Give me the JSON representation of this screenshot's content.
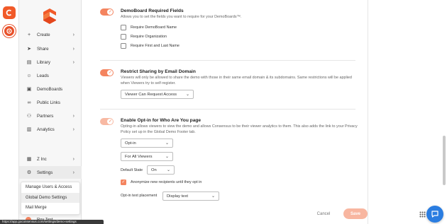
{
  "sidebar": {
    "items": [
      {
        "label": "Create",
        "icon": "plus-icon",
        "chevron": true
      },
      {
        "label": "Share",
        "icon": "send-icon",
        "chevron": true
      },
      {
        "label": "Library",
        "icon": "library-icon",
        "chevron": true
      },
      {
        "label": "Leads",
        "icon": "user-icon",
        "chevron": false
      },
      {
        "label": "DemoBoards",
        "icon": "board-icon",
        "chevron": false
      },
      {
        "label": "Public Links",
        "icon": "link-icon",
        "chevron": false
      },
      {
        "label": "Partners",
        "icon": "partners-icon",
        "chevron": true
      },
      {
        "label": "Analytics",
        "icon": "analytics-icon",
        "chevron": true
      }
    ],
    "org": {
      "label": "Z Inc",
      "icon": "building-icon"
    },
    "settings": {
      "label": "Settings",
      "icon": "gear-icon"
    },
    "user": {
      "label": "Roy Test"
    }
  },
  "settings_menu": {
    "items": [
      {
        "label": "Manage Users & Access",
        "selected": false
      },
      {
        "label": "Global Demo Settings",
        "selected": true
      },
      {
        "label": "Mail Merge",
        "selected": false
      }
    ]
  },
  "sections": {
    "required_fields": {
      "title": "DemoBoard Required Fields",
      "description": "Allows you to set the fields you want to require for your DemoBoards™.",
      "options": [
        {
          "label": "Require DemoBoard Name",
          "checked": false
        },
        {
          "label": "Require Organization",
          "checked": false
        },
        {
          "label": "Require First and Last Name",
          "checked": false
        }
      ]
    },
    "restrict_sharing": {
      "title": "Restrict Sharing by Email Domain",
      "description": "Viewers will only be allowed to share the demo with those in their same email domain & its subdomains. Same restrictions will be applied when Viewers try to self-register.",
      "select_value": "Viewer Can Request Access"
    },
    "opt_in": {
      "title": "Enable Opt-in for Who Are You page",
      "description": "Opting-in allows viewers to view the demo and allows Consensus to be their viewer analytics to them. This also adds the link to your Privacy Policy set up in the Global Demo Footer tab.",
      "mode_value": "Opt-in",
      "audience_value": "For All Viewers",
      "default_state_label": "Default State",
      "default_state_value": "On",
      "anonymize_label": "Anonymize new recipients until they opt in",
      "anonymize_checked": true,
      "placement_label": "Opt-in text placement",
      "placement_value": "Display text"
    }
  },
  "footer": {
    "cancel_label": "Cancel",
    "save_label": "Save"
  },
  "status_url": "https://app.goconsensus.com/settings/demo-settings",
  "colors": {
    "accent": "#f4845f",
    "brand": "#f15a29",
    "chat": "#2a7de1"
  }
}
